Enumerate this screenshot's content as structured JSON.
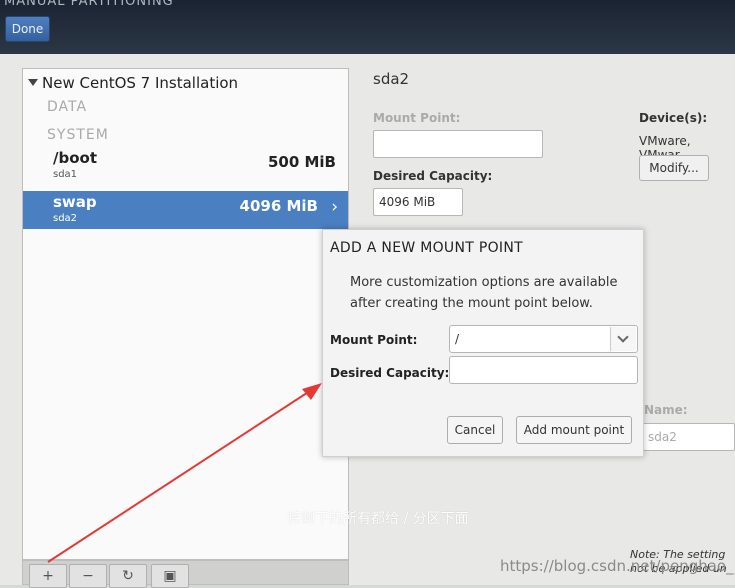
{
  "header": {
    "title": "MANUAL PARTITIONING",
    "done_label": "Done"
  },
  "left_pane": {
    "installation_title": "New CentOS 7 Installation",
    "sections": [
      "DATA",
      "SYSTEM"
    ],
    "partitions": [
      {
        "mount": "/boot",
        "device": "sda1",
        "size": "500 MiB",
        "selected": false
      },
      {
        "mount": "swap",
        "device": "sda2",
        "size": "4096 MiB",
        "selected": true
      }
    ],
    "toolbar": {
      "add_icon": "plus-icon",
      "remove_icon": "minus-icon",
      "refresh_icon": "refresh-icon",
      "configure_icon": "disk-settings-icon"
    }
  },
  "right_pane": {
    "title": "sda2",
    "mount_point_label": "Mount Point:",
    "mount_point_value": "",
    "desired_capacity_label": "Desired Capacity:",
    "desired_capacity_value": "4096 MiB",
    "devices_label": "Device(s):",
    "devices_value": "VMware, VMwar",
    "modify_label": "Modify...",
    "name_label": "Name:",
    "name_value": "sda2",
    "note_line1": "Note:  The setting",
    "note_line2": "not be applied un"
  },
  "dialog": {
    "title": "ADD A NEW MOUNT POINT",
    "description_line1": "More customization options are available",
    "description_line2": "after creating the mount point below.",
    "mount_point_label": "Mount Point:",
    "mount_point_value": "/",
    "desired_capacity_label": "Desired Capacity:",
    "desired_capacity_value": "",
    "cancel_label": "Cancel",
    "add_label": "Add mount point"
  },
  "annotation": {
    "text": "将剩下的所有都给 / 分区下面",
    "color": "#e53935"
  },
  "watermark": "https://blog.csdn.net/penghao_1"
}
